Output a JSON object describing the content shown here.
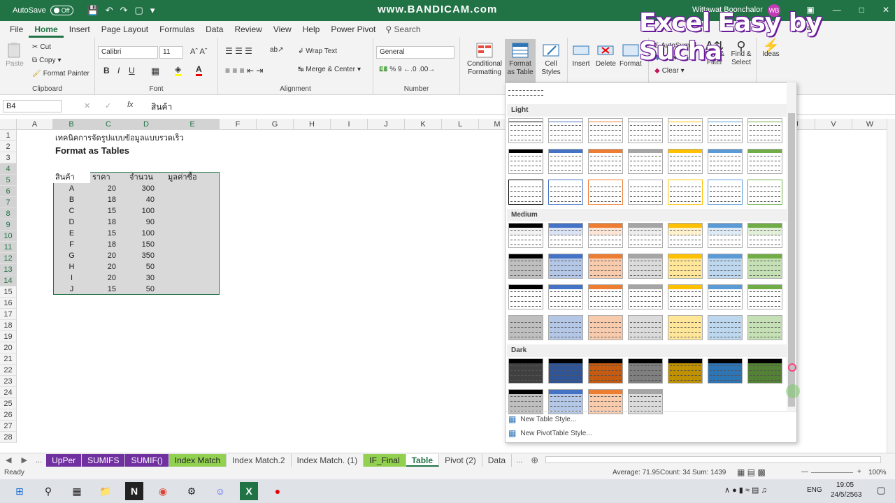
{
  "titlebar": {
    "autosave_label": "AutoSave",
    "autosave_state": "Off",
    "watermark": "www.BANDICAM.com",
    "user": "Wittawat Boonchalor",
    "avatar_initials": "WB",
    "brand": "Excel Easy by Sucha"
  },
  "menu": {
    "tabs": [
      "File",
      "Home",
      "Insert",
      "Page Layout",
      "Formulas",
      "Data",
      "Review",
      "View",
      "Help",
      "Power Pivot"
    ],
    "active": "Home",
    "search": "Search",
    "share": "Sha"
  },
  "ribbon": {
    "clipboard": {
      "label": "Clipboard",
      "paste": "Paste",
      "cut": "Cut",
      "copy": "Copy",
      "painter": "Format Painter"
    },
    "font": {
      "label": "Font",
      "name": "Calibri",
      "size": "11",
      "bold": "B",
      "italic": "I",
      "underline": "U"
    },
    "alignment": {
      "label": "Alignment",
      "wrap": "Wrap Text",
      "merge": "Merge & Center"
    },
    "number": {
      "label": "Number",
      "format": "General"
    },
    "styles": {
      "conditional": "Conditional Formatting",
      "table": "Format as Table",
      "cell": "Cell Styles"
    },
    "cells": {
      "insert": "Insert",
      "delete": "Delete",
      "format": "Format"
    },
    "editing": {
      "autosum": "AutoSum",
      "fill": "Fill",
      "clear": "Clear",
      "sort": "Sort & Filter",
      "find": "Find & Select"
    },
    "ideas": "Ideas"
  },
  "formula_bar": {
    "namebox": "B4",
    "fx": "fx",
    "content": "สินค้า"
  },
  "columns": [
    "A",
    "B",
    "C",
    "D",
    "E",
    "F",
    "G",
    "H",
    "I",
    "J",
    "K",
    "L",
    "M",
    "N",
    "O",
    "P",
    "Q",
    "R",
    "S",
    "T",
    "U",
    "V",
    "W"
  ],
  "visible_columns": [
    "A",
    "B",
    "C",
    "D",
    "E",
    "F",
    "G",
    "H",
    "I",
    "J",
    "K",
    "L",
    "M",
    "J",
    "V",
    "W"
  ],
  "rows": [
    "1",
    "2",
    "3",
    "4",
    "5",
    "6",
    "7",
    "8",
    "9",
    "10",
    "11",
    "12",
    "13",
    "14",
    "15",
    "16",
    "17",
    "18",
    "19",
    "20",
    "21",
    "22",
    "23",
    "24",
    "25",
    "26",
    "27",
    "28"
  ],
  "sheet": {
    "b1": "เทคนิคการจัดรูปแบบข้อมูลแบบรวดเร็ว",
    "b2": "Format as Tables",
    "headers": [
      "สินค้า",
      "ราคา",
      "จำนวน",
      "มูลค่าซื้อ"
    ],
    "data": [
      [
        "A",
        "20",
        "300"
      ],
      [
        "B",
        "18",
        "40"
      ],
      [
        "C",
        "15",
        "100"
      ],
      [
        "D",
        "18",
        "90"
      ],
      [
        "E",
        "15",
        "100"
      ],
      [
        "F",
        "18",
        "150"
      ],
      [
        "G",
        "20",
        "350"
      ],
      [
        "H",
        "20",
        "50"
      ],
      [
        "I",
        "20",
        "30"
      ],
      [
        "J",
        "15",
        "50"
      ]
    ]
  },
  "dropdown": {
    "light": "Light",
    "medium": "Medium",
    "dark": "Dark",
    "new_table": "New Table Style...",
    "new_pivot": "New PivotTable Style..."
  },
  "sheet_tabs": [
    {
      "name": "UpPer",
      "style": "purple"
    },
    {
      "name": "SUMIFS",
      "style": "purple"
    },
    {
      "name": "SUMIF()",
      "style": "purple"
    },
    {
      "name": "Index Match",
      "style": "green"
    },
    {
      "name": "Index Match.2",
      "style": "plain"
    },
    {
      "name": "Index Match. (1)",
      "style": "plain"
    },
    {
      "name": "IF_Final",
      "style": "green"
    },
    {
      "name": "Table",
      "style": "active"
    },
    {
      "name": "Pivot (2)",
      "style": "plain"
    },
    {
      "name": "Data",
      "style": "plain"
    }
  ],
  "status": {
    "ready": "Ready",
    "average": "Average: 71.95",
    "count": "Count: 34",
    "sum": "Sum: 1439",
    "zoom": "100%"
  },
  "taskbar": {
    "lang": "ENG",
    "time": "19:05",
    "date": "24/5/2563"
  }
}
